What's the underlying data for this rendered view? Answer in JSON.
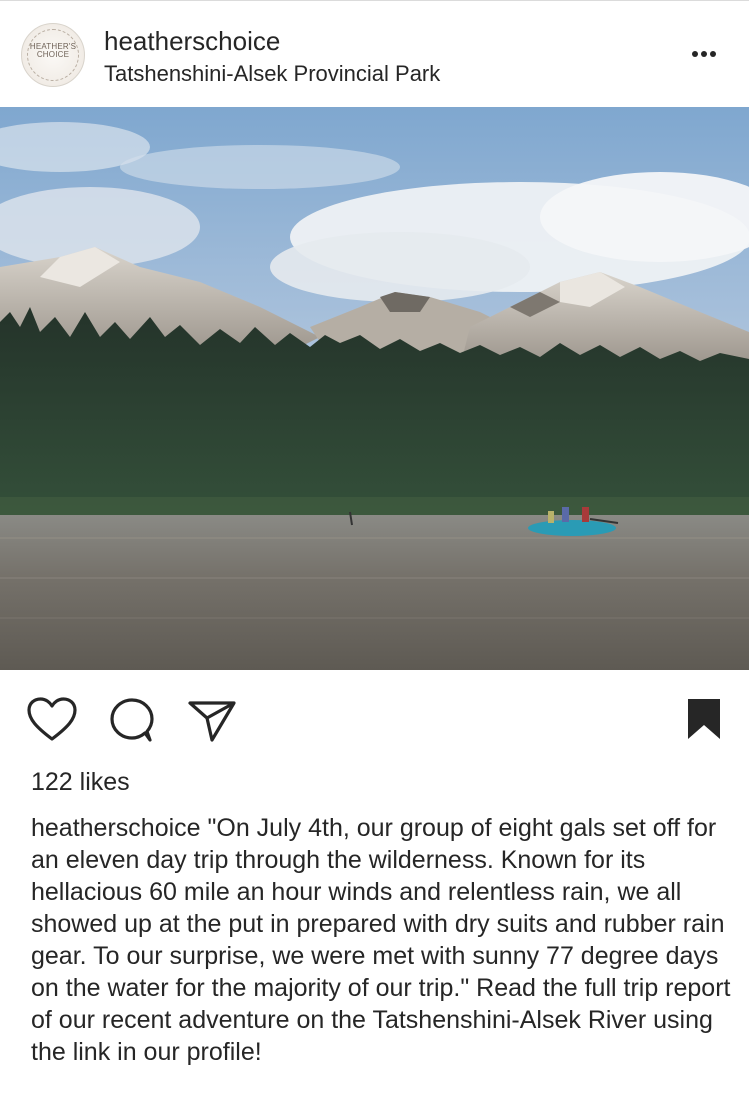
{
  "post": {
    "username": "heatherschoice",
    "location": "Tatshenshini-Alsek Provincial Park",
    "avatar_text": "HEATHER'S CHOICE",
    "likes": "122 likes",
    "caption_user": "heatherschoice",
    "caption_text": "\"On July 4th, our group of eight gals set off for an eleven day trip through the wilderness. Known for its hellacious 60 mile an hour winds and relentless rain, we all showed up at the put in prepared with dry suits and rubber rain gear. To our surprise, we were met with sunny 77 degree days on the water for the majority of our trip.\" Read the full trip report of our recent adventure on the Tatshenshini-Alsek River using the link in our profile!"
  },
  "icons": {
    "more": "more-options-icon",
    "like": "heart-icon",
    "comment": "comment-icon",
    "share": "send-icon",
    "save": "bookmark-icon"
  },
  "colors": {
    "text": "#262626",
    "raft": "#2a9bb5",
    "water": "#6b6760",
    "forest": "#1f2d20",
    "sky": "#8eb3d6"
  }
}
